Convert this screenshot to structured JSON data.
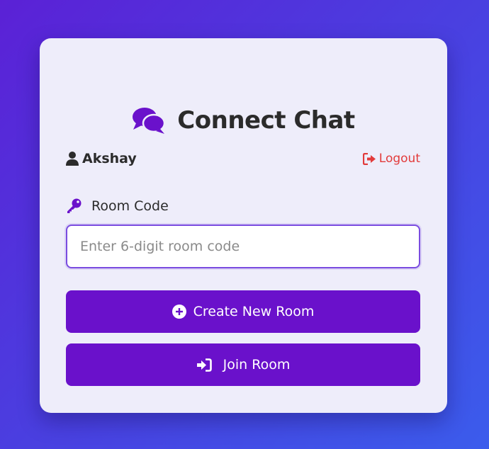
{
  "app": {
    "title": "Connect Chat",
    "icon": "comments-icon"
  },
  "user": {
    "name": "Akshay",
    "icon": "user-icon"
  },
  "logout": {
    "label": "Logout",
    "icon": "sign-out-icon",
    "color": "#e23b3b"
  },
  "room_code": {
    "label": "Room Code",
    "icon": "key-icon",
    "placeholder": "Enter 6-digit room code",
    "value": ""
  },
  "actions": {
    "create_label": "Create New Room",
    "create_icon": "plus-circle-icon",
    "join_label": "Join Room",
    "join_icon": "sign-in-icon"
  },
  "colors": {
    "accent": "#6a11cb",
    "card_bg": "#eeedfa",
    "background_start": "#5b21d6",
    "background_end": "#3b5cec"
  }
}
